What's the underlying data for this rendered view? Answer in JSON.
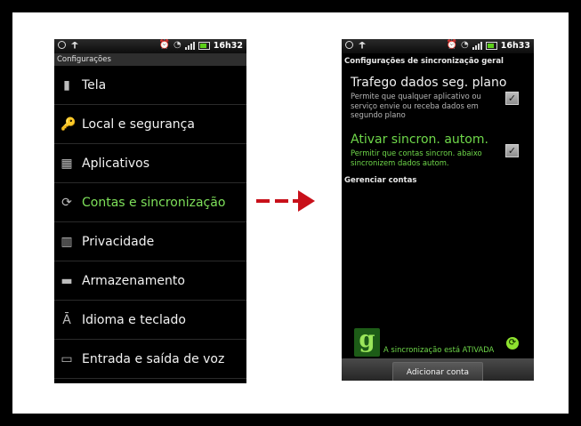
{
  "left_screen": {
    "status_time": "16h32",
    "title": "Configurações",
    "items": [
      {
        "label": "Tela",
        "icon": "screen-icon"
      },
      {
        "label": "Local e segurança",
        "icon": "key-icon"
      },
      {
        "label": "Aplicativos",
        "icon": "apps-icon"
      },
      {
        "label": "Contas e sincronização",
        "icon": "sync-icon",
        "active": true
      },
      {
        "label": "Privacidade",
        "icon": "privacy-icon"
      },
      {
        "label": "Armazenamento",
        "icon": "storage-icon"
      },
      {
        "label": "Idioma e teclado",
        "icon": "language-icon"
      },
      {
        "label": "Entrada e saída de voz",
        "icon": "voice-icon"
      }
    ]
  },
  "right_screen": {
    "status_time": "16h33",
    "section_general": "Configurações de sincronização geral",
    "background_data": {
      "title": "Trafego dados seg. plano",
      "description": "Permite que qualquer aplicativo ou serviço envie ou receba dados em segundo plano",
      "checked": true
    },
    "auto_sync": {
      "title": "Ativar sincron. autom.",
      "description": "Permitir que contas sincron. abaixo sincronizem dados autom.",
      "checked": true
    },
    "section_accounts": "Gerenciar contas",
    "account_logo": "g",
    "sync_status": "A sincronização está ATIVADA",
    "add_account_button": "Adicionar conta"
  },
  "colors": {
    "accent_green": "#6fd84a",
    "arrow_red": "#c8101a"
  }
}
